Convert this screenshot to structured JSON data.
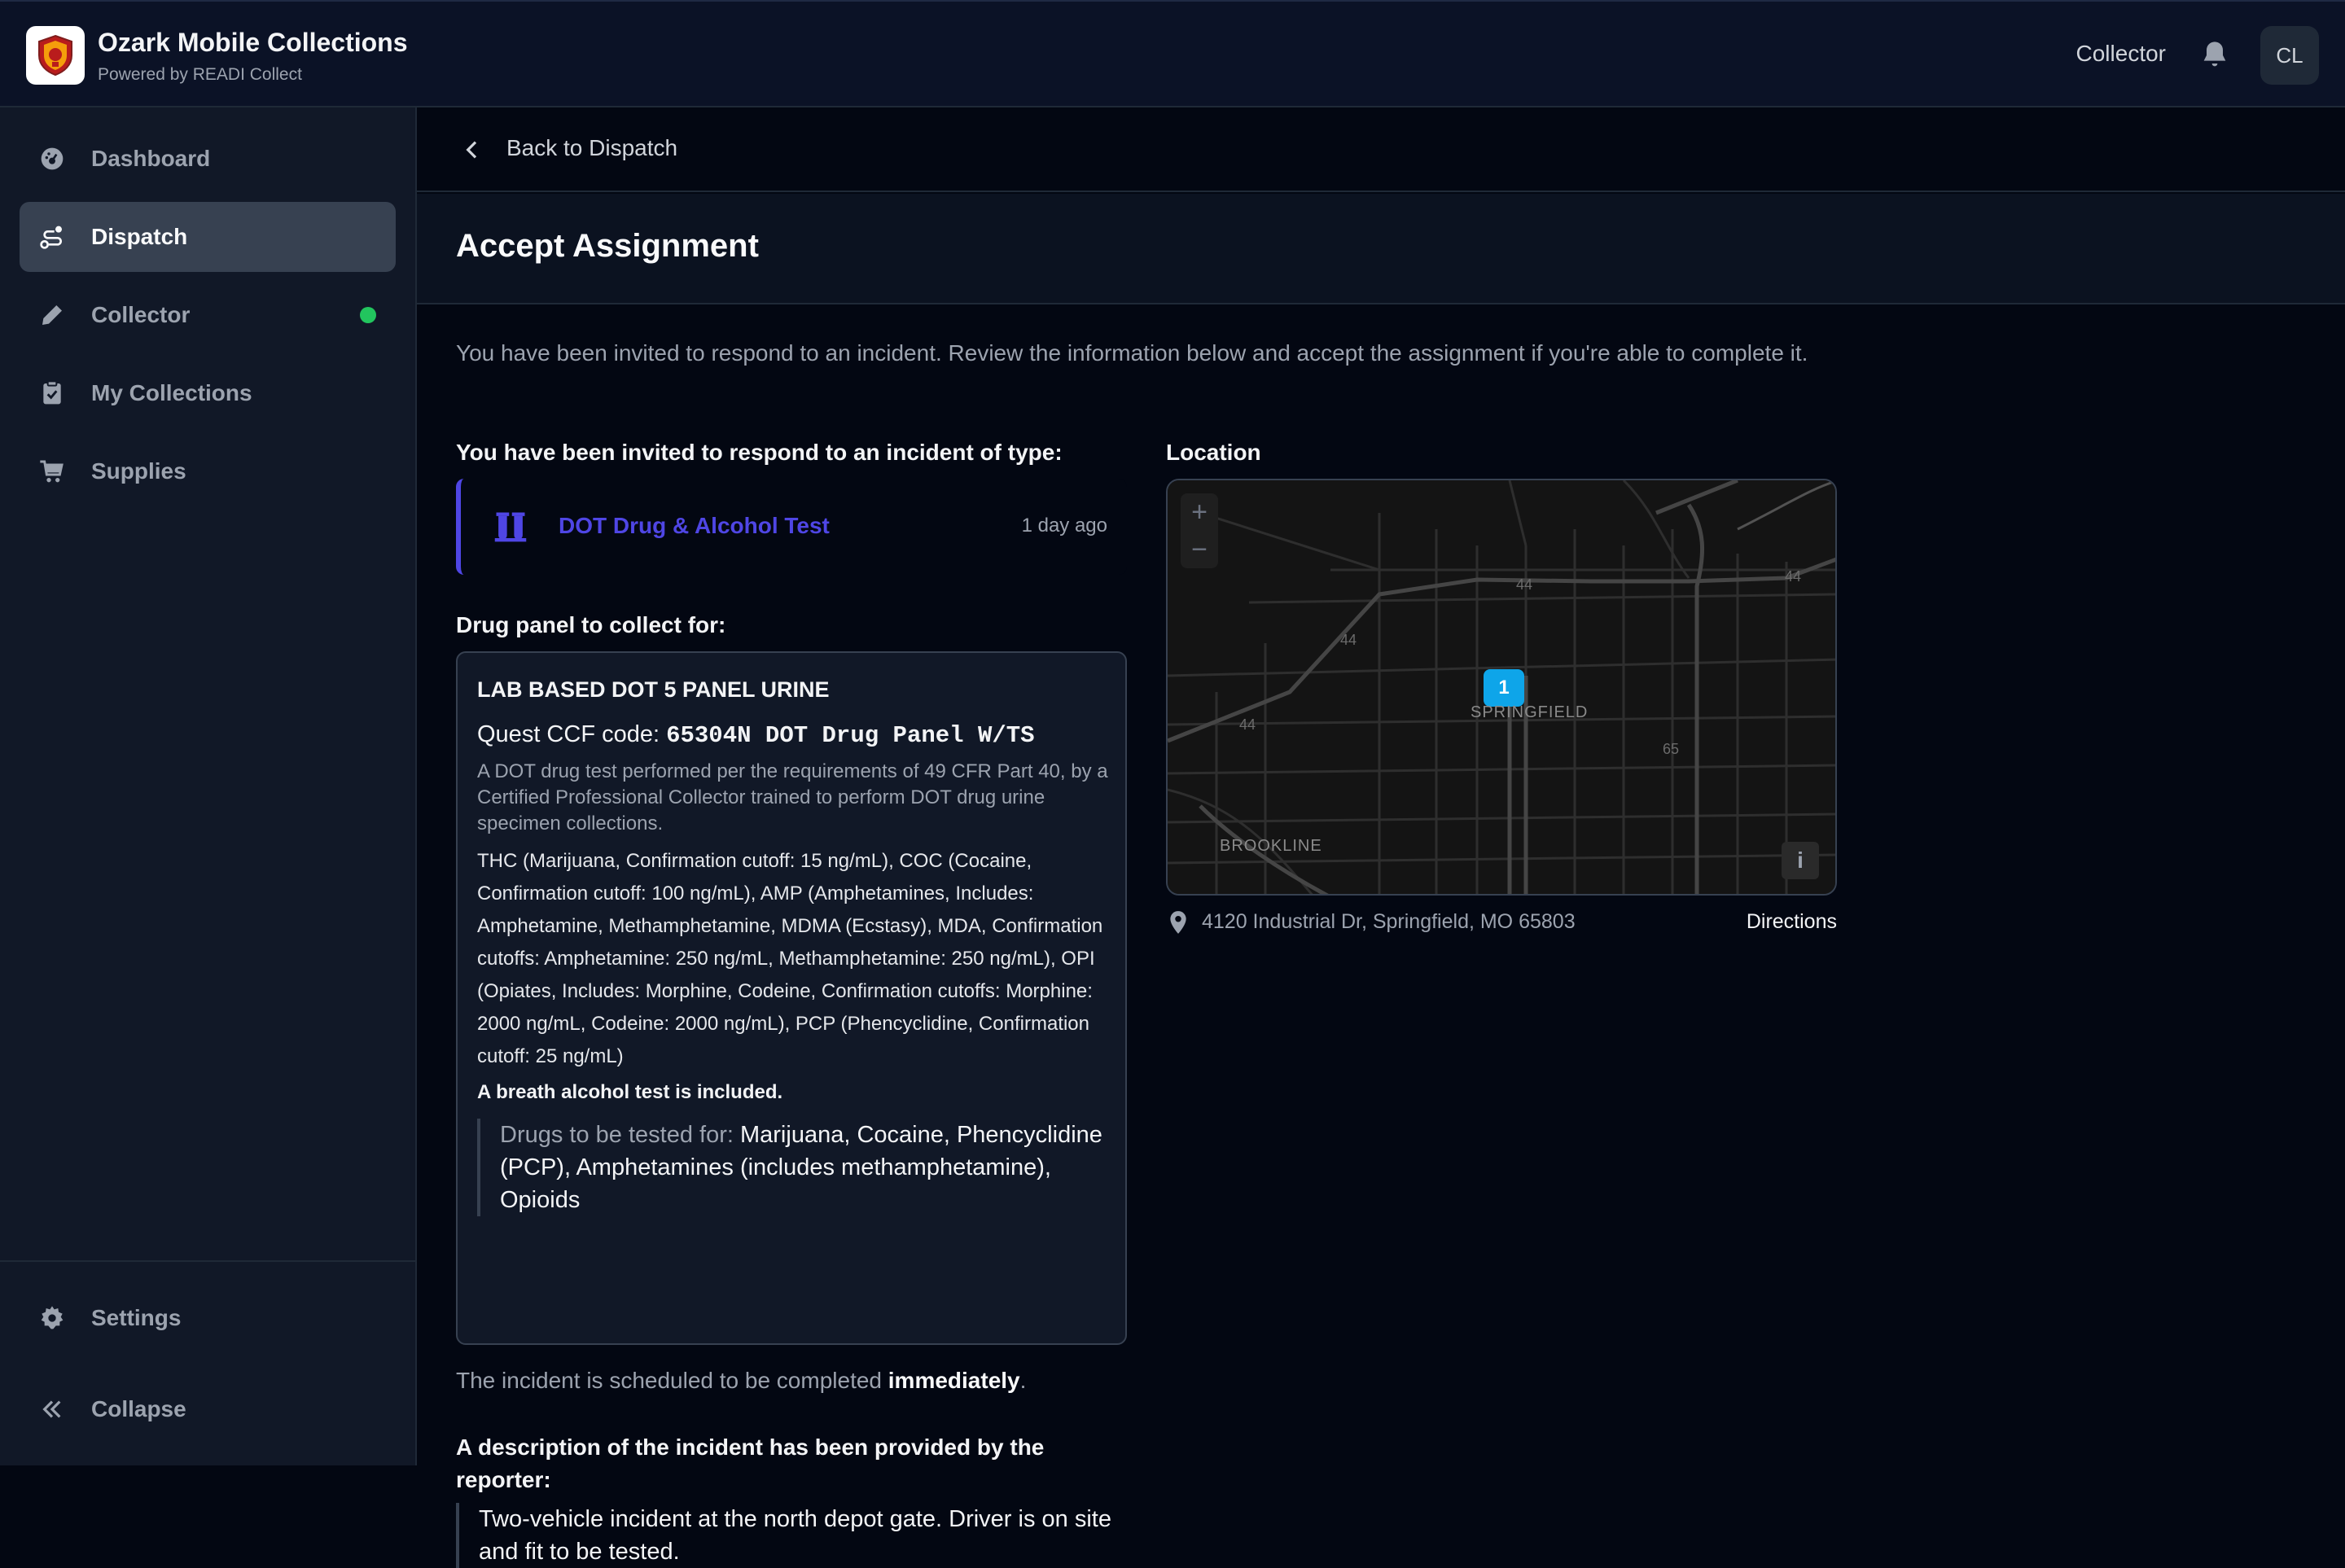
{
  "header": {
    "app_title": "Ozark Mobile Collections",
    "app_subtitle": "Powered by READI Collect",
    "role_label": "Collector",
    "avatar_initials": "CL"
  },
  "sidebar": {
    "items": [
      {
        "label": "Dashboard",
        "icon": "dashboard-icon",
        "active": false
      },
      {
        "label": "Dispatch",
        "icon": "dispatch-icon",
        "active": true
      },
      {
        "label": "Collector",
        "icon": "pen-icon",
        "active": false,
        "status_color": "#22c55e"
      },
      {
        "label": "My Collections",
        "icon": "clipboard-check-icon",
        "active": false
      },
      {
        "label": "Supplies",
        "icon": "cart-icon",
        "active": false
      }
    ],
    "settings_label": "Settings",
    "collapse_label": "Collapse"
  },
  "main": {
    "back_label": "Back to Dispatch",
    "page_title": "Accept Assignment",
    "intro": "You have been invited to respond to an incident. Review the information below and accept the assignment if you're able to complete it.",
    "incident_type_heading": "You have been invited to respond to an incident of type:",
    "incident": {
      "name": "DOT Drug & Alcohol Test",
      "time_ago": "1 day ago",
      "accent_color": "#4f46e5"
    },
    "panel_heading": "Drug panel to collect for:",
    "panel": {
      "name": "LAB BASED DOT 5 PANEL URINE",
      "code_label": "Quest CCF code: ",
      "code_value": "65304N DOT Drug Panel W/TS",
      "description": "A DOT drug test performed per the requirements of 49 CFR Part 40, by a Certified Professional Collector trained to perform DOT drug urine specimen collections.",
      "drugs_detail": "THC (Marijuana, Confirmation cutoff: 15 ng/mL), COC (Cocaine, Confirmation cutoff: 100 ng/mL), AMP (Amphetamines, Includes: Amphetamine, Methamphetamine, MDMA (Ecstasy), MDA, Confirmation cutoffs: Amphetamine: 250 ng/mL, Methamphetamine: 250 ng/mL), OPI (Opiates, Includes: Morphine, Codeine, Confirmation cutoffs: Morphine: 2000 ng/mL, Codeine: 2000 ng/mL), PCP (Phencyclidine, Confirmation cutoff: 25 ng/mL)",
      "breath_note": "A breath alcohol test is included.",
      "tested_for_label": "Drugs to be tested for: ",
      "tested_for_value": "Marijuana, Cocaine, Phencyclidine (PCP), Amphetamines (includes methamphetamine), Opioids"
    },
    "schedule_prefix": "The incident is scheduled to be completed ",
    "schedule_value": "immediately",
    "schedule_suffix": ".",
    "description_heading": "A description of the incident has been provided by the reporter:",
    "description_text": "Two-vehicle incident at the north depot gate. Driver is on site and fit to be tested."
  },
  "location": {
    "heading": "Location",
    "map": {
      "zoom_in": "+",
      "zoom_out": "−",
      "marker_label": "1",
      "city_label": "SPRINGFIELD",
      "area_label": "BROOKLINE",
      "route_labels": [
        "44",
        "44",
        "44",
        "44",
        "65"
      ],
      "info_label": "i"
    },
    "address": "4120 Industrial Dr, Springfield, MO 65803",
    "directions_label": "Directions"
  }
}
